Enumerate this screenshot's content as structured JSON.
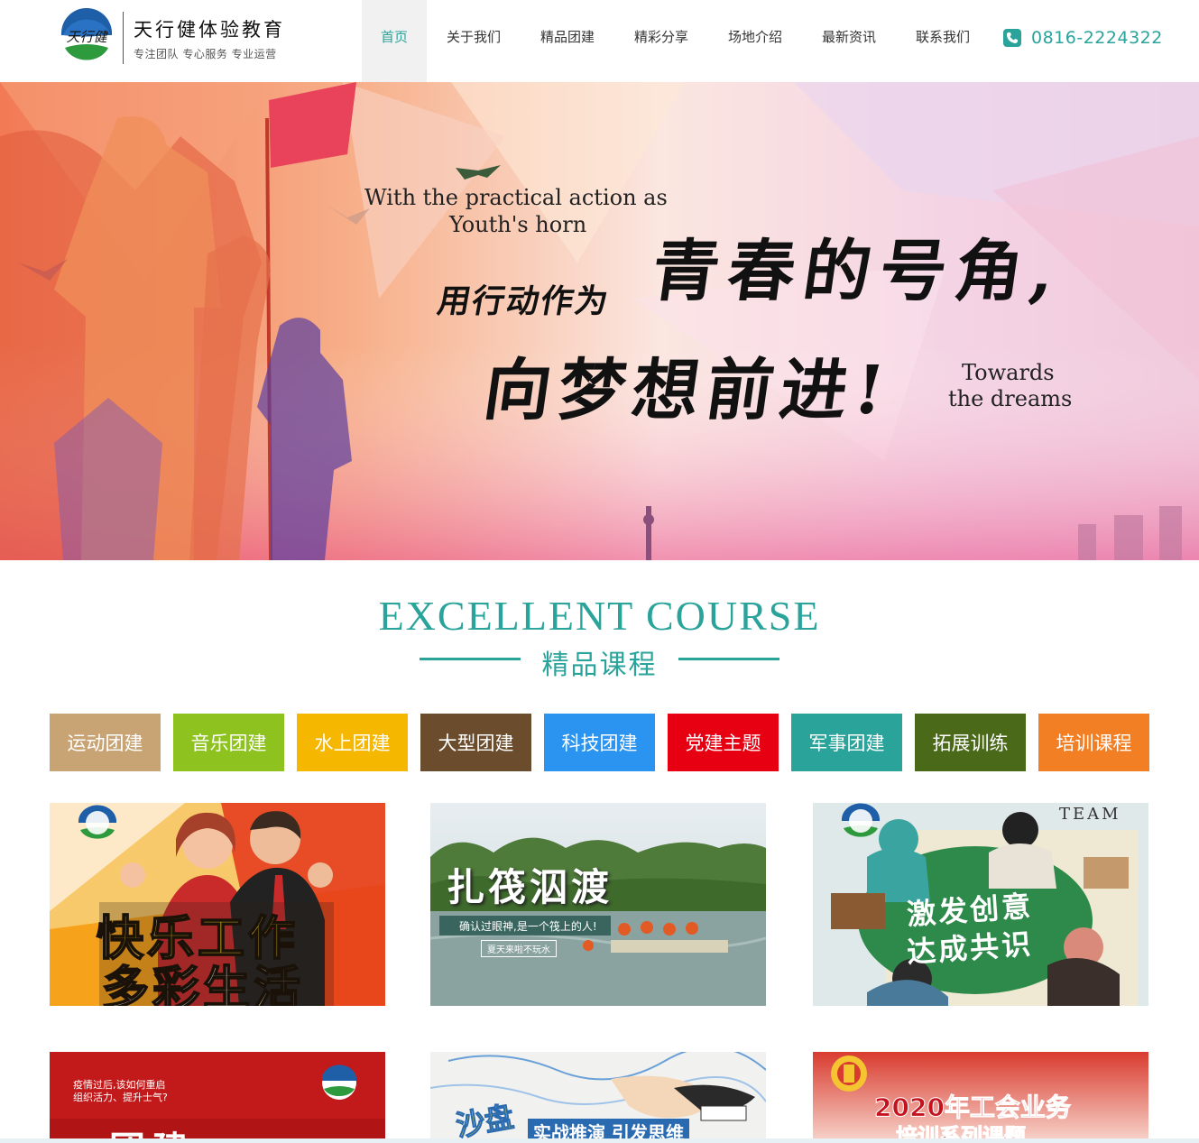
{
  "header": {
    "logo_mark_text": "天行健",
    "logo_name": "天行健体验教育",
    "logo_slogan": "专注团队 专心服务 专业运营",
    "phone": "0816-2224322"
  },
  "nav": [
    {
      "label": "首页",
      "active": true
    },
    {
      "label": "关于我们"
    },
    {
      "label": "精品团建"
    },
    {
      "label": "精彩分享"
    },
    {
      "label": "场地介绍"
    },
    {
      "label": "最新资讯"
    },
    {
      "label": "联系我们"
    }
  ],
  "banner": {
    "en_line1": "With the practical action as",
    "en_line2": "Youth's horn",
    "cn_small": "用行动作为",
    "cn_big1": "青春的号角,",
    "cn_big2": "向梦想前进!",
    "en_line3": "Towards",
    "en_line4": "the dreams"
  },
  "section": {
    "title_en": "EXCELLENT  COURSE",
    "title_cn": "精品课程"
  },
  "categories": [
    {
      "label": "运动团建",
      "color": "#c8a474"
    },
    {
      "label": "音乐团建",
      "color": "#8dc21f"
    },
    {
      "label": "水上团建",
      "color": "#f5b700"
    },
    {
      "label": "大型团建",
      "color": "#6b4c2d"
    },
    {
      "label": "科技团建",
      "color": "#2b93f0"
    },
    {
      "label": "党建主题",
      "color": "#e60012"
    },
    {
      "label": "军事团建",
      "color": "#2aa39b"
    },
    {
      "label": "拓展训练",
      "color": "#4a6a1a"
    },
    {
      "label": "培训课程",
      "color": "#f37f25"
    }
  ],
  "cards": {
    "c1": {
      "line1": "快乐工作",
      "line2": "多彩生活"
    },
    "c2": {
      "title": "扎筏泅渡",
      "caption": "确认过眼神,是一个筏上的人!",
      "sub": "夏天来啦不玩水"
    },
    "c3": {
      "corner": "TEAM",
      "line1": "激发创意",
      "line2": "达成共识"
    },
    "c4": {
      "line1": "疫情过后,该如何重启",
      "line2": "组织活力、提升士气?",
      "big": "团建"
    },
    "c5": {
      "big": "沙盘",
      "sub": "实战推演 引发思维"
    },
    "c6": {
      "line1": "2020年工会业务",
      "line2": "培训系列课题"
    }
  }
}
